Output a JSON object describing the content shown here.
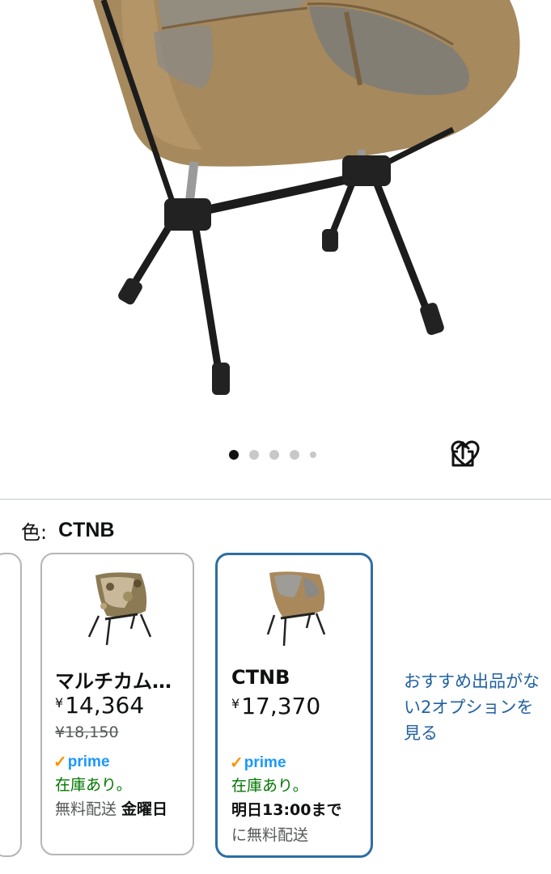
{
  "hero": {
    "image_alt": "chair-product-image",
    "pagination": {
      "total": 5,
      "active_index": 0
    },
    "wishlist_icon": "heart-icon",
    "share_icon": "share-icon"
  },
  "variation": {
    "label": "色:",
    "selected_value": "CTNB"
  },
  "options": [
    {
      "name": "マルチカム…",
      "currency": "¥",
      "price": "14,364",
      "list_price": "¥18,150",
      "prime_label": "prime",
      "stock": "在庫あり。",
      "shipping_prefix": "無料配送 ",
      "shipping_bold": "金曜日",
      "shipping_suffix": ""
    },
    {
      "name": "CTNB",
      "currency": "¥",
      "price": "17,370",
      "list_price": "",
      "prime_label": "prime",
      "stock": "在庫あり。",
      "shipping_prefix": "",
      "shipping_bold": "明日13:00まで",
      "shipping_suffix": "に無料配送"
    }
  ],
  "see_more_link": "おすすめ出品がない2オプションを見る",
  "colors": {
    "accent_blue": "#2e6da4",
    "link_blue": "#2162a1",
    "stock_green": "#007600",
    "prime_blue": "#1a98ff",
    "prime_check": "#f79400",
    "chair_brown": "#a98b5e"
  }
}
